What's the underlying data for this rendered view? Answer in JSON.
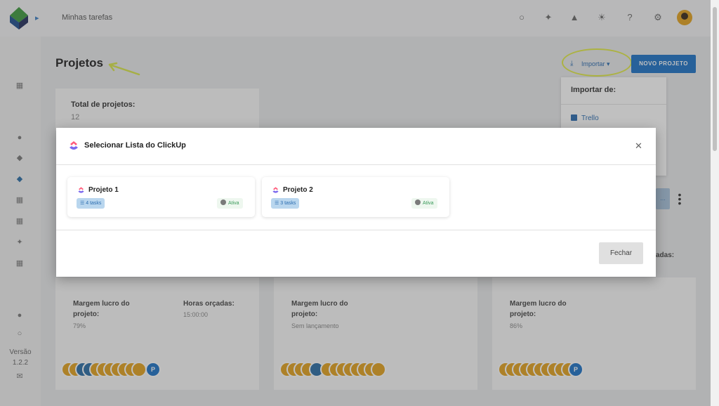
{
  "header": {
    "title": "Minhas tarefas",
    "icons": [
      "search-icon",
      "grid-icon",
      "bell-icon",
      "sun-icon",
      "help-icon",
      "gear-icon",
      "avatar"
    ]
  },
  "sidebar": {
    "version_label": "Versão",
    "version_number": "1.2.2"
  },
  "main": {
    "title": "Projetos",
    "import_label": "Importar",
    "new_project_label": "NOVO PROJETO",
    "import_menu": {
      "title": "Importar de:",
      "items": [
        "Trello"
      ]
    },
    "total": {
      "label": "Total de projetos:",
      "value": "12"
    },
    "cards": [
      {
        "margin_label": "Margem lucro do projeto:",
        "margin_value": "79%",
        "hours_label": "Horas orçadas:",
        "hours_value": "15:00:00",
        "p_label": "P"
      },
      {
        "margin_label": "Margem lucro do projeto:",
        "margin_value": "Sem lançamento"
      },
      {
        "margin_label": "Margem lucro do projeto:",
        "margin_value": "86%",
        "p_label": "P",
        "right_text": "adas:"
      }
    ]
  },
  "modal": {
    "title": "Selecionar Lista do ClickUp",
    "lists": [
      {
        "name": "Projeto 1",
        "tasks": "4 tasks",
        "status": "Ativa"
      },
      {
        "name": "Projeto 2",
        "tasks": "3 tasks",
        "status": "Ativa"
      }
    ],
    "close_label": "Fechar"
  },
  "colors": {
    "accent": "#1e73c8",
    "highlight": "#e2eb46",
    "active": "#3a9b5a"
  }
}
